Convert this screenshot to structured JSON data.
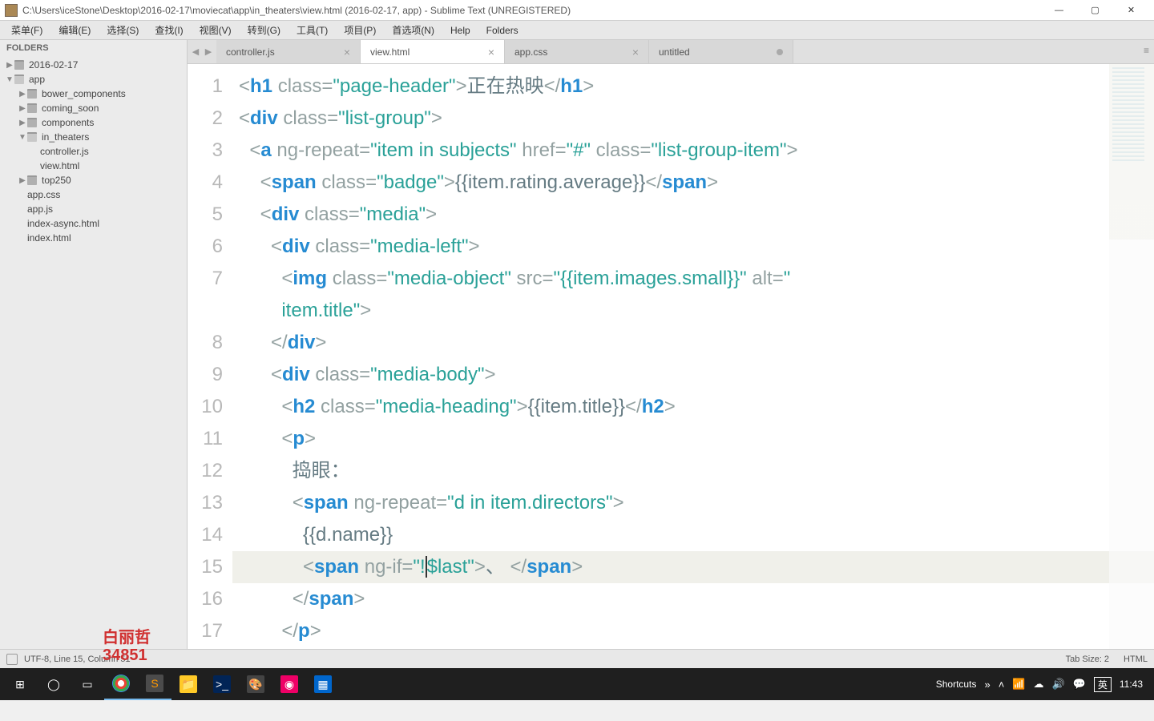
{
  "window": {
    "title": "C:\\Users\\iceStone\\Desktop\\2016-02-17\\moviecat\\app\\in_theaters\\view.html (2016-02-17, app) - Sublime Text (UNREGISTERED)"
  },
  "menu": {
    "items": [
      "菜单(F)",
      "编辑(E)",
      "选择(S)",
      "查找(I)",
      "视图(V)",
      "转到(G)",
      "工具(T)",
      "项目(P)",
      "首选项(N)",
      "Help",
      "Folders"
    ]
  },
  "sidebar": {
    "header": "FOLDERS",
    "tree": [
      {
        "depth": 0,
        "arrow": "▶",
        "icon": "closed",
        "label": "2016-02-17"
      },
      {
        "depth": 0,
        "arrow": "▼",
        "icon": "open",
        "label": "app"
      },
      {
        "depth": 1,
        "arrow": "▶",
        "icon": "closed",
        "label": "bower_components"
      },
      {
        "depth": 1,
        "arrow": "▶",
        "icon": "closed",
        "label": "coming_soon"
      },
      {
        "depth": 1,
        "arrow": "▶",
        "icon": "closed",
        "label": "components"
      },
      {
        "depth": 1,
        "arrow": "▼",
        "icon": "open",
        "label": "in_theaters"
      },
      {
        "depth": 2,
        "arrow": "",
        "icon": "",
        "label": "controller.js"
      },
      {
        "depth": 2,
        "arrow": "",
        "icon": "",
        "label": "view.html"
      },
      {
        "depth": 1,
        "arrow": "▶",
        "icon": "closed",
        "label": "top250"
      },
      {
        "depth": 1,
        "arrow": "",
        "icon": "",
        "label": "app.css"
      },
      {
        "depth": 1,
        "arrow": "",
        "icon": "",
        "label": "app.js"
      },
      {
        "depth": 1,
        "arrow": "",
        "icon": "",
        "label": "index-async.html"
      },
      {
        "depth": 1,
        "arrow": "",
        "icon": "",
        "label": "index.html"
      }
    ]
  },
  "tabs": {
    "nav_prev": "◀",
    "nav_next": "▶",
    "items": [
      {
        "label": "controller.js",
        "active": false,
        "dirty": false
      },
      {
        "label": "view.html",
        "active": true,
        "dirty": false
      },
      {
        "label": "app.css",
        "active": false,
        "dirty": false
      },
      {
        "label": "untitled",
        "active": false,
        "dirty": true
      }
    ],
    "menu": "≡"
  },
  "editor": {
    "line_numbers": [
      "1",
      "2",
      "3",
      "4",
      "5",
      "6",
      "7",
      "",
      "8",
      "9",
      "10",
      "11",
      "12",
      "13",
      "14",
      "15",
      "16",
      "17"
    ],
    "highlighted_line_index": 14,
    "lines": [
      [
        {
          "t": "<",
          "c": "p-punc"
        },
        {
          "t": "h1",
          "c": "p-tag"
        },
        {
          "t": " class",
          "c": "p-attr"
        },
        {
          "t": "=",
          "c": "p-punc"
        },
        {
          "t": "\"page-header\"",
          "c": "p-str"
        },
        {
          "t": ">",
          "c": "p-punc"
        },
        {
          "t": "正在热映",
          "c": "p-text"
        },
        {
          "t": "</",
          "c": "p-punc"
        },
        {
          "t": "h1",
          "c": "p-tag"
        },
        {
          "t": ">",
          "c": "p-punc"
        }
      ],
      [
        {
          "t": "<",
          "c": "p-punc"
        },
        {
          "t": "div",
          "c": "p-tag"
        },
        {
          "t": " class",
          "c": "p-attr"
        },
        {
          "t": "=",
          "c": "p-punc"
        },
        {
          "t": "\"list-group\"",
          "c": "p-str"
        },
        {
          "t": ">",
          "c": "p-punc"
        }
      ],
      [
        {
          "t": "  ",
          "c": ""
        },
        {
          "t": "<",
          "c": "p-punc"
        },
        {
          "t": "a",
          "c": "p-tag"
        },
        {
          "t": " ng-repeat",
          "c": "p-attr"
        },
        {
          "t": "=",
          "c": "p-punc"
        },
        {
          "t": "\"item in subjects\"",
          "c": "p-str"
        },
        {
          "t": " href",
          "c": "p-attr"
        },
        {
          "t": "=",
          "c": "p-punc"
        },
        {
          "t": "\"#\"",
          "c": "p-str"
        },
        {
          "t": " class",
          "c": "p-attr"
        },
        {
          "t": "=",
          "c": "p-punc"
        },
        {
          "t": "\"list-group-item\"",
          "c": "p-str"
        },
        {
          "t": ">",
          "c": "p-punc"
        }
      ],
      [
        {
          "t": "    ",
          "c": ""
        },
        {
          "t": "<",
          "c": "p-punc"
        },
        {
          "t": "span",
          "c": "p-tag"
        },
        {
          "t": " class",
          "c": "p-attr"
        },
        {
          "t": "=",
          "c": "p-punc"
        },
        {
          "t": "\"badge\"",
          "c": "p-str"
        },
        {
          "t": ">",
          "c": "p-punc"
        },
        {
          "t": "{{item.rating.average}}",
          "c": "p-text"
        },
        {
          "t": "</",
          "c": "p-punc"
        },
        {
          "t": "span",
          "c": "p-tag"
        },
        {
          "t": ">",
          "c": "p-punc"
        }
      ],
      [
        {
          "t": "    ",
          "c": ""
        },
        {
          "t": "<",
          "c": "p-punc"
        },
        {
          "t": "div",
          "c": "p-tag"
        },
        {
          "t": " class",
          "c": "p-attr"
        },
        {
          "t": "=",
          "c": "p-punc"
        },
        {
          "t": "\"media\"",
          "c": "p-str"
        },
        {
          "t": ">",
          "c": "p-punc"
        }
      ],
      [
        {
          "t": "      ",
          "c": ""
        },
        {
          "t": "<",
          "c": "p-punc"
        },
        {
          "t": "div",
          "c": "p-tag"
        },
        {
          "t": " class",
          "c": "p-attr"
        },
        {
          "t": "=",
          "c": "p-punc"
        },
        {
          "t": "\"media-left\"",
          "c": "p-str"
        },
        {
          "t": ">",
          "c": "p-punc"
        }
      ],
      [
        {
          "t": "        ",
          "c": ""
        },
        {
          "t": "<",
          "c": "p-punc"
        },
        {
          "t": "img",
          "c": "p-tag"
        },
        {
          "t": " class",
          "c": "p-attr"
        },
        {
          "t": "=",
          "c": "p-punc"
        },
        {
          "t": "\"media-object\"",
          "c": "p-str"
        },
        {
          "t": " src",
          "c": "p-attr"
        },
        {
          "t": "=",
          "c": "p-punc"
        },
        {
          "t": "\"{{item.images.small}}\"",
          "c": "p-str"
        },
        {
          "t": " alt",
          "c": "p-attr"
        },
        {
          "t": "=",
          "c": "p-punc"
        },
        {
          "t": "\"",
          "c": "p-str"
        }
      ],
      [
        {
          "t": "        ",
          "c": ""
        },
        {
          "t": "item.title\"",
          "c": "p-str"
        },
        {
          "t": ">",
          "c": "p-punc"
        }
      ],
      [
        {
          "t": "      ",
          "c": ""
        },
        {
          "t": "</",
          "c": "p-punc"
        },
        {
          "t": "div",
          "c": "p-tag"
        },
        {
          "t": ">",
          "c": "p-punc"
        }
      ],
      [
        {
          "t": "      ",
          "c": ""
        },
        {
          "t": "<",
          "c": "p-punc"
        },
        {
          "t": "div",
          "c": "p-tag"
        },
        {
          "t": " class",
          "c": "p-attr"
        },
        {
          "t": "=",
          "c": "p-punc"
        },
        {
          "t": "\"media-body\"",
          "c": "p-str"
        },
        {
          "t": ">",
          "c": "p-punc"
        }
      ],
      [
        {
          "t": "        ",
          "c": ""
        },
        {
          "t": "<",
          "c": "p-punc"
        },
        {
          "t": "h2",
          "c": "p-tag"
        },
        {
          "t": " class",
          "c": "p-attr"
        },
        {
          "t": "=",
          "c": "p-punc"
        },
        {
          "t": "\"media-heading\"",
          "c": "p-str"
        },
        {
          "t": ">",
          "c": "p-punc"
        },
        {
          "t": "{{item.title}}",
          "c": "p-text"
        },
        {
          "t": "</",
          "c": "p-punc"
        },
        {
          "t": "h2",
          "c": "p-tag"
        },
        {
          "t": ">",
          "c": "p-punc"
        }
      ],
      [
        {
          "t": "        ",
          "c": ""
        },
        {
          "t": "<",
          "c": "p-punc"
        },
        {
          "t": "p",
          "c": "p-tag"
        },
        {
          "t": ">",
          "c": "p-punc"
        }
      ],
      [
        {
          "t": "          ",
          "c": ""
        },
        {
          "t": "捣眼：",
          "c": "p-text"
        }
      ],
      [
        {
          "t": "          ",
          "c": ""
        },
        {
          "t": "<",
          "c": "p-punc"
        },
        {
          "t": "span",
          "c": "p-tag"
        },
        {
          "t": " ng-repeat",
          "c": "p-attr"
        },
        {
          "t": "=",
          "c": "p-punc"
        },
        {
          "t": "\"d in item.directors\"",
          "c": "p-str"
        },
        {
          "t": ">",
          "c": "p-punc"
        }
      ],
      [
        {
          "t": "            ",
          "c": ""
        },
        {
          "t": "{{d.name}}",
          "c": "p-text"
        }
      ],
      [
        {
          "t": "            ",
          "c": ""
        },
        {
          "t": "<",
          "c": "p-punc"
        },
        {
          "t": "span",
          "c": "p-tag"
        },
        {
          "t": " ng-if",
          "c": "p-attr"
        },
        {
          "t": "=",
          "c": "p-punc"
        },
        {
          "t": "\"!",
          "c": "p-str"
        },
        {
          "t": "",
          "c": "p-cursor"
        },
        {
          "t": "$last\"",
          "c": "p-str"
        },
        {
          "t": ">",
          "c": "p-punc"
        },
        {
          "t": "、 ",
          "c": "p-text"
        },
        {
          "t": "</",
          "c": "p-punc"
        },
        {
          "t": "span",
          "c": "p-tag"
        },
        {
          "t": ">",
          "c": "p-punc"
        }
      ],
      [
        {
          "t": "          ",
          "c": ""
        },
        {
          "t": "</",
          "c": "p-punc"
        },
        {
          "t": "span",
          "c": "p-tag"
        },
        {
          "t": ">",
          "c": "p-punc"
        }
      ],
      [
        {
          "t": "        ",
          "c": ""
        },
        {
          "t": "</",
          "c": "p-punc"
        },
        {
          "t": "p",
          "c": "p-tag"
        },
        {
          "t": ">",
          "c": "p-punc"
        }
      ]
    ]
  },
  "statusbar": {
    "encoding": "UTF-8, Line 15, Column 51",
    "tabsize": "Tab Size: 2",
    "syntax": "HTML"
  },
  "watermark": {
    "line1": "白丽哲",
    "line2": "34851"
  },
  "taskbar": {
    "shortcuts_label": "Shortcuts",
    "ime": "英",
    "clock": "11:43"
  }
}
